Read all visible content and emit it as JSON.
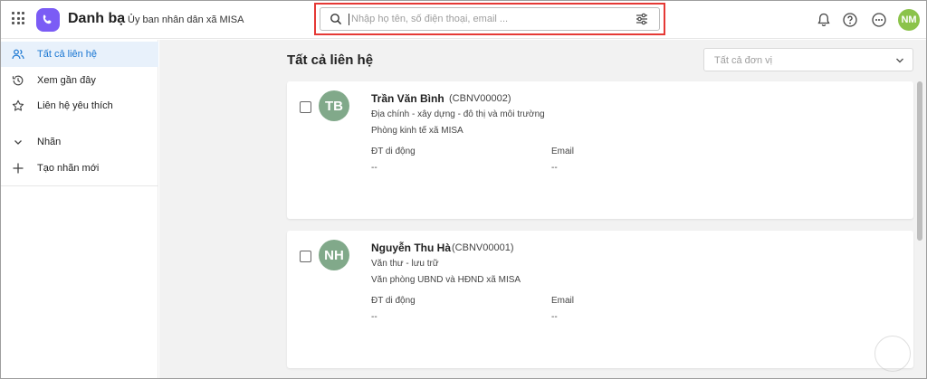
{
  "header": {
    "app_title": "Danh bạ",
    "org_name": "Ủy ban nhân dân xã MISA",
    "search": {
      "value": "",
      "placeholder": "Nhập họ tên, số điện thoại, email ..."
    },
    "avatar_initials": "NM",
    "icons": [
      "apps-grid-icon",
      "app-logo-icon",
      "search-icon",
      "filter-sliders-icon",
      "bell-icon",
      "help-icon",
      "more-icon"
    ]
  },
  "sidebar": {
    "items": [
      {
        "label": "Tất cả liên hệ",
        "icon": "contacts-icon",
        "active": true
      },
      {
        "label": "Xem gần đây",
        "icon": "history-icon",
        "active": false
      },
      {
        "label": "Liên hệ yêu thích",
        "icon": "star-icon",
        "active": false
      },
      {
        "label": "Nhãn",
        "icon": "chevron-down-icon",
        "active": false
      },
      {
        "label": "Tạo nhãn mới",
        "icon": "plus-icon",
        "active": false
      }
    ]
  },
  "main": {
    "title": "Tất cả liên hệ",
    "unit_filter": {
      "value": "",
      "placeholder": "Tất cả đơn vị"
    },
    "field_labels": {
      "mobile": "ĐT di động",
      "email": "Email"
    },
    "contacts": [
      {
        "initials": "TB",
        "name": "Trần Văn Bình",
        "code": "(CBNV00002)",
        "position": "Địa chính - xây dựng - đô thị và môi trường",
        "department": "Phòng kinh tế xã MISA",
        "mobile": "--",
        "email": "--"
      },
      {
        "initials": "NH",
        "name": "Nguyễn Thu Hà",
        "code": "(CBNV00001)",
        "position": "Văn thư - lưu trữ",
        "department": "Văn phòng UBND và HĐND xã MISA",
        "mobile": "--",
        "email": "--"
      }
    ]
  },
  "colors": {
    "accent": "#1976d2",
    "logo": "#7b5cf5",
    "contact_avatar": "#81a98a",
    "user_avatar": "#8bc34a",
    "highlight": "#e53935"
  }
}
